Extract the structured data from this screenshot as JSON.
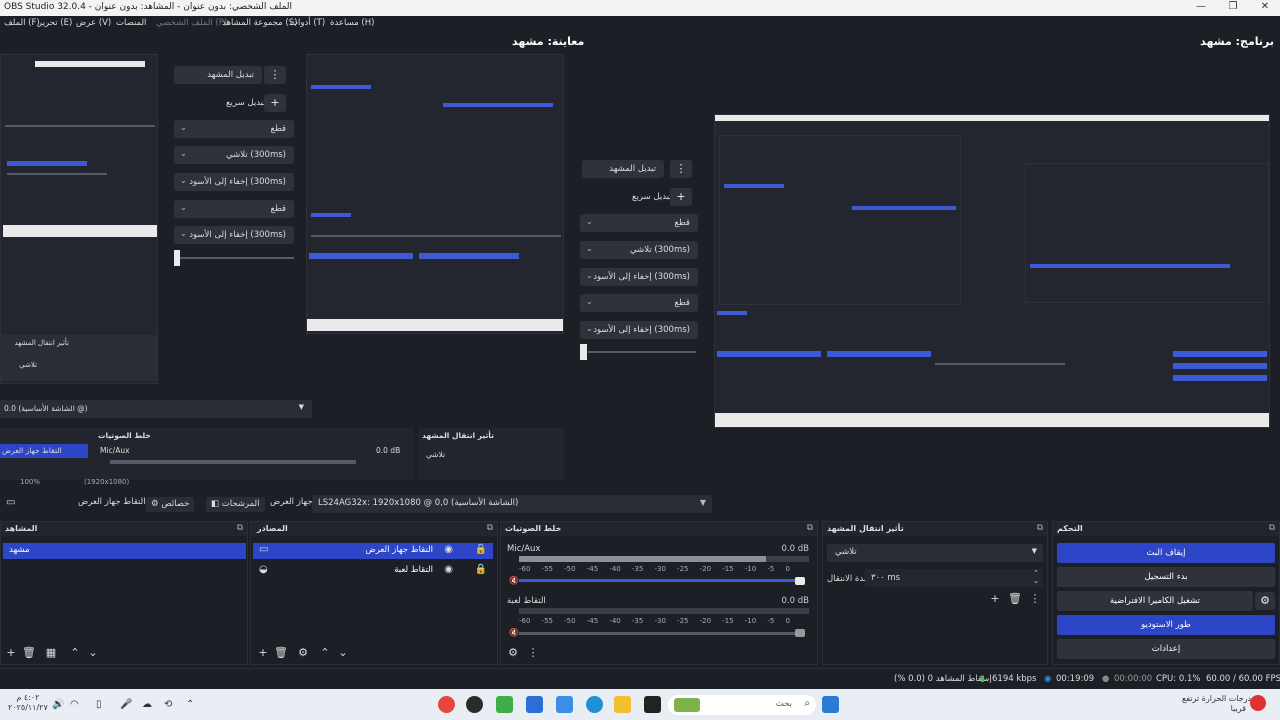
{
  "window": {
    "title": "OBS Studio 32.0.4 - الملف الشخصي: بدون عنوان - المشاهد: بدون عنوان",
    "controls": [
      "—",
      "❐",
      "✕"
    ]
  },
  "menu": {
    "items": [
      "الملف (F)",
      "تحرير (E)",
      "عرض (V)",
      "المنصات",
      "الملف الشخصي (P)",
      "مجموعة المشاهد (S)",
      "أدوات (T)",
      "مساعدة (H)"
    ]
  },
  "preview": {
    "title": "معاينة: مشهد"
  },
  "program": {
    "title": "برنامج: مشهد"
  },
  "transition_panel": {
    "edit_scene": "تبديل المشهد",
    "quick_transitions": "تبديل سريع",
    "rows": [
      "قطع",
      "تلاشي (300ms)",
      "إخفاء إلى الأسود (300ms)",
      "قطع",
      "إخفاء إلى الأسود (300ms)"
    ]
  },
  "nested_preview": {
    "select_value": "الشاشة الأساسية) 0.0 @)",
    "mixer_title": "خلط الصوتيات",
    "transition_title": "تأثير انتقال المشهد",
    "transition_value": "تلاشي",
    "source_name": "التقاط جهاز العرض",
    "mic_name": "Mic/Aux",
    "mic_db": "0.0 dB",
    "zoom": "100%",
    "canvas": "(1920x1080)",
    "scene_transition_title": "تأثير انتقال المشهد",
    "scene_transition_value": "تلاشي"
  },
  "canvas_bar": {
    "source_label": "التقاط جهاز العرض",
    "properties": "خصائص",
    "filters": "المرشحات",
    "device_label": "جهاز العرض",
    "display_value": "LS24AG32x: 1920x1080 @ 0,0 (الشاشة الأساسية)"
  },
  "docks": {
    "scenes": {
      "title": "المشاهد",
      "items": [
        "مشهد"
      ]
    },
    "sources": {
      "title": "المصادر",
      "items": [
        {
          "name": "التقاط جهاز العرض",
          "icon": "monitor-icon"
        },
        {
          "name": "التقاط لعبة",
          "icon": "gamepad-icon"
        }
      ]
    },
    "mixer": {
      "title": "خلط الصوتيات",
      "channels": [
        {
          "name": "Mic/Aux",
          "db": "0.0 dB",
          "level": 0.85
        },
        {
          "name": "التقاط لعبة",
          "db": "0.0 dB",
          "level": 0.0
        }
      ],
      "ticks": [
        "-60",
        "-55",
        "-50",
        "-45",
        "-40",
        "-35",
        "-30",
        "-25",
        "-20",
        "-15",
        "-10",
        "-5",
        "0"
      ]
    },
    "transitions": {
      "title": "تأثير انتقال المشهد",
      "type": "تلاشي",
      "duration_label": "مدة الانتقال",
      "duration_value": "٣٠٠ ms"
    },
    "controls": {
      "title": "التحكم",
      "buttons": [
        "إيقاف البث",
        "بدء التسجيل",
        "تشغيل الكاميرا الافتراضية",
        "طور الاستوديو",
        "إعدادات"
      ]
    }
  },
  "status": {
    "dropped": "إسقاط المشاهد 0 (0.0 %)",
    "bitrate": "6194 kbps",
    "live_time": "00:19:09",
    "rec_time": "00:00:00",
    "cpu": "CPU: 0.1%",
    "fps": "60.00 / 60.00 FPS"
  },
  "taskbar": {
    "search_placeholder": "بحث",
    "weather": "درجات الحرارة ترتفع",
    "weather_sub": "قريبا",
    "time": "٤:٠٢ م",
    "date": "٢٠٢٥/١١/٢٧"
  },
  "colors": {
    "accent": "#2c46c7",
    "bg": "#1d1f26",
    "panel": "#2f323b"
  }
}
